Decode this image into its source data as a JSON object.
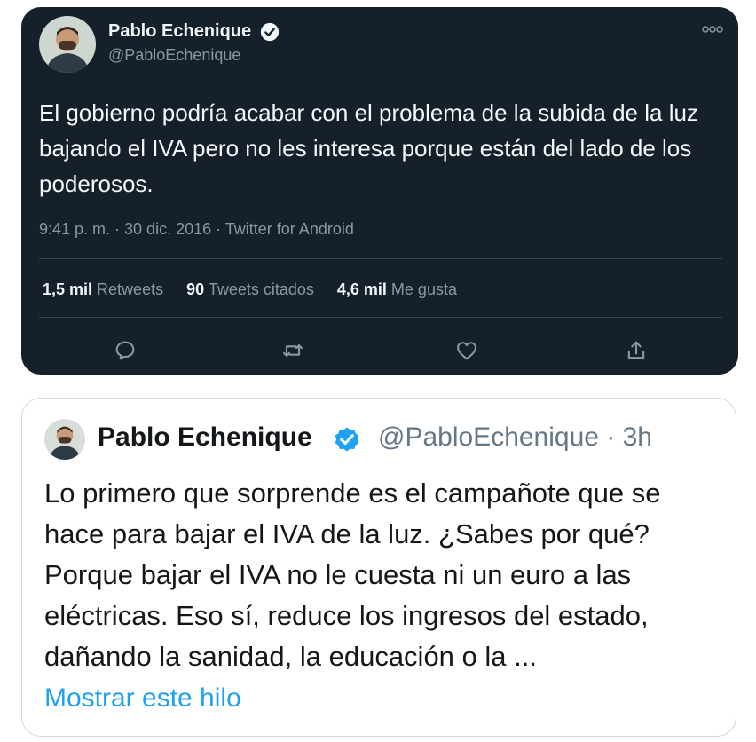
{
  "dark_tweet": {
    "name": "Pablo Echenique",
    "handle": "@PabloEchenique",
    "text": "El gobierno podría acabar con el problema de la subida de la luz bajando el IVA pero no les interesa porque están del lado de los poderosos.",
    "meta": "9:41 p. m. · 30 dic. 2016 · Twitter for Android",
    "stats": {
      "retweets_value": "1,5 mil",
      "retweets_label": "Retweets",
      "quotes_value": "90",
      "quotes_label": "Tweets citados",
      "likes_value": "4,6 mil",
      "likes_label": "Me gusta"
    },
    "icons": [
      "reply-icon",
      "retweet-icon",
      "like-icon",
      "share-icon",
      "more-options-icon",
      "verified-badge-icon"
    ]
  },
  "light_tweet": {
    "name": "Pablo Echenique",
    "handle_time": "@PabloEchenique · 3h",
    "text": "Lo primero que sorprende es el campañote que se hace para bajar el IVA de la luz. ¿Sabes por qué? Porque bajar el IVA no le cuesta ni un euro a las eléctricas. Eso sí, reduce los ingresos del estado, dañando la sanidad, la educación o la ...",
    "show_thread": "Mostrar este hilo"
  },
  "colors": {
    "dark_bg": "#15202b",
    "verified_blue": "#1da1f2",
    "link_blue": "#1da1f2",
    "muted_text": "#8899a6"
  }
}
